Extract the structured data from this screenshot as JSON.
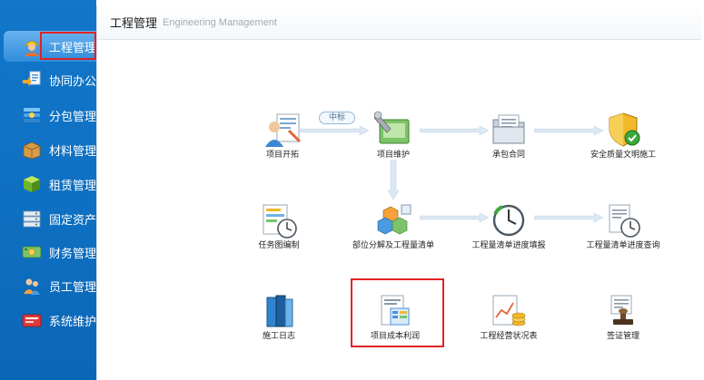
{
  "sidebar": {
    "items": [
      {
        "label": "工程管理",
        "icon": "worker-icon"
      },
      {
        "label": "协同办公",
        "icon": "collaboration-icon"
      },
      {
        "label": "分包管理",
        "icon": "subcontract-icon"
      },
      {
        "label": "材料管理",
        "icon": "material-box-icon"
      },
      {
        "label": "租赁管理",
        "icon": "lease-cube-icon"
      },
      {
        "label": "固定资产",
        "icon": "fixed-asset-icon"
      },
      {
        "label": "财务管理",
        "icon": "finance-icon"
      },
      {
        "label": "员工管理",
        "icon": "staff-icon"
      },
      {
        "label": "系统维护",
        "icon": "system-maintenance-icon"
      }
    ],
    "active_index": 0
  },
  "header": {
    "title": "工程管理",
    "subtitle": "Engineering Management"
  },
  "flow": {
    "tag_label": "中标",
    "nodes": {
      "project_start": "项目开拓",
      "project_maintain": "项目维护",
      "contract": "承包合同",
      "safety": "安全质量文明施工",
      "task_chart": "任务图编制",
      "decompose": "部位分解及工程量清单",
      "progress_fill": "工程量清单进度填报",
      "progress_query": "工程量清单进度查询",
      "construction_log": "施工日志",
      "cost_profit": "项目成本利润",
      "business_status": "工程经营状况表",
      "visa": "签证管理"
    }
  },
  "colors": {
    "sidebar_bg": "#0e6fc1",
    "highlight": "#e02323",
    "arrow": "#dbe7f2"
  }
}
